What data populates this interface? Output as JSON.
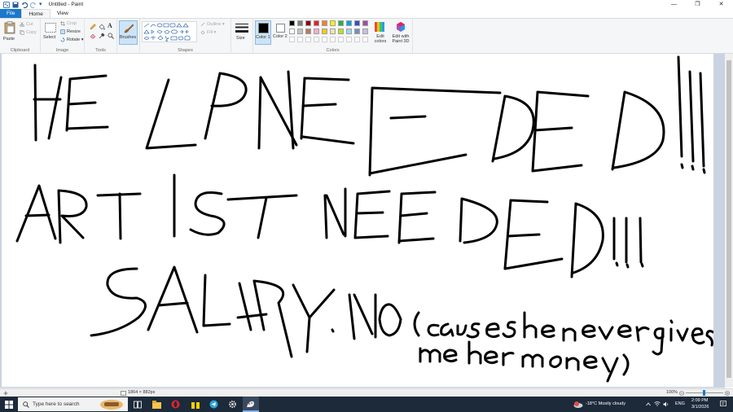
{
  "titlebar": {
    "title": "Untitled - Paint",
    "qa_dropdown": "▾",
    "minimize": "—",
    "restore": "❐",
    "close": "✕"
  },
  "tabs": {
    "file": "File",
    "home": "Home",
    "view": "View"
  },
  "ribbon": {
    "clipboard": {
      "paste": "Paste",
      "cut": "Cut",
      "copy": "Copy",
      "label": "Clipboard"
    },
    "image": {
      "select": "Select",
      "crop": "Crop",
      "resize": "Resize",
      "rotate": "Rotate ▾",
      "label": "Image"
    },
    "tools": {
      "label": "Tools",
      "text_tool": "A"
    },
    "brushes": {
      "label": "Brushes"
    },
    "shapes": {
      "outline": "Outline ▾",
      "fill": "Fill ▾",
      "label": "Shapes"
    },
    "size": {
      "label": "Size"
    },
    "colors": {
      "color1": "Color 1",
      "color2": "Color 2",
      "edit_colors": "Edit colors",
      "edit_with_paint3d": "Edit with Paint 3D",
      "label": "Colors",
      "color1_value": "#000000",
      "color2_value": "#ffffff",
      "palette_row1": [
        "#000000",
        "#7f7f7f",
        "#880015",
        "#ed1c24",
        "#ff7f27",
        "#fff200",
        "#22b14c",
        "#00a2e8",
        "#3f48cc",
        "#a349a4"
      ],
      "palette_row2": [
        "#ffffff",
        "#c3c3c3",
        "#b97a57",
        "#ffaec9",
        "#ffc90e",
        "#efe4b0",
        "#b5e61d",
        "#99d9ea",
        "#7092be",
        "#c8bfe7"
      ]
    }
  },
  "canvas": {
    "line1": "HELP NEEDED!!!",
    "line2": "ARTIST NEEDED!!!",
    "line3": "SALARY: NO (cause she never gives",
    "line4": "me her money)"
  },
  "status": {
    "dimensions": "1864 × 882px",
    "zoom": "100%"
  },
  "taskbar": {
    "search_placeholder": "Type here to search",
    "weather": "-18°C  Mostly cloudy",
    "lang": "ENG",
    "time": "2:09 PM",
    "date": "3/1/2026"
  }
}
